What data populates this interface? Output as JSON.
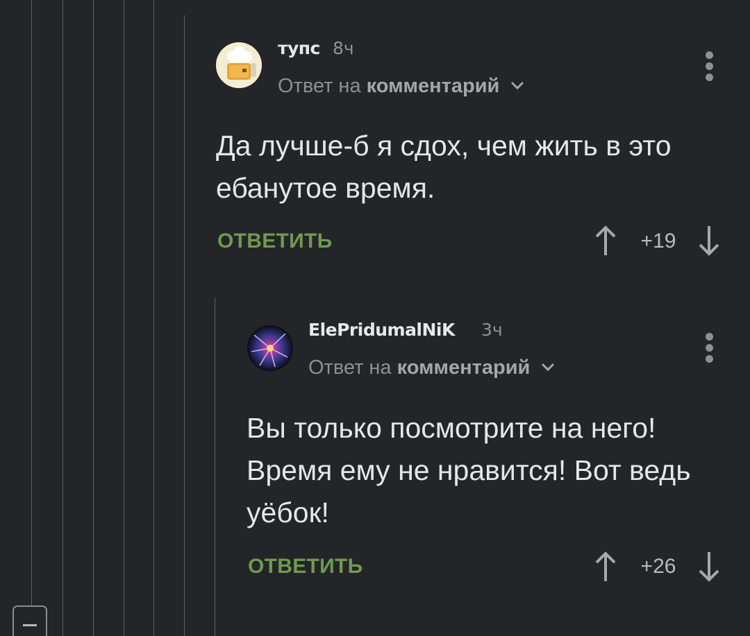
{
  "thread": {
    "collapse_icon": "minus-icon"
  },
  "comments": [
    {
      "username": "тупс",
      "time": "8ч",
      "reply_prefix": "Ответ на",
      "reply_link": "комментарий",
      "text": "Да лучше-б я сдох, чем жить в это ебанутое время.",
      "reply_label": "ОТВЕТИТЬ",
      "score": "+19",
      "avatar_icon": "chef-hat-toast-avatar"
    },
    {
      "username": "ElePridumalNiK",
      "time": "3ч",
      "reply_prefix": "Ответ на",
      "reply_link": "комментарий",
      "text": "Вы только посмотрите на него! Время ему не нравится! Вот ведь уёбок!",
      "reply_label": "ОТВЕТИТЬ",
      "score": "+26",
      "avatar_icon": "plasma-ball-avatar"
    }
  ],
  "colors": {
    "background": "#232529",
    "accent_green": "#6f9a4f",
    "thread_line": "#5c5f64",
    "muted_text": "#8c8f93"
  }
}
